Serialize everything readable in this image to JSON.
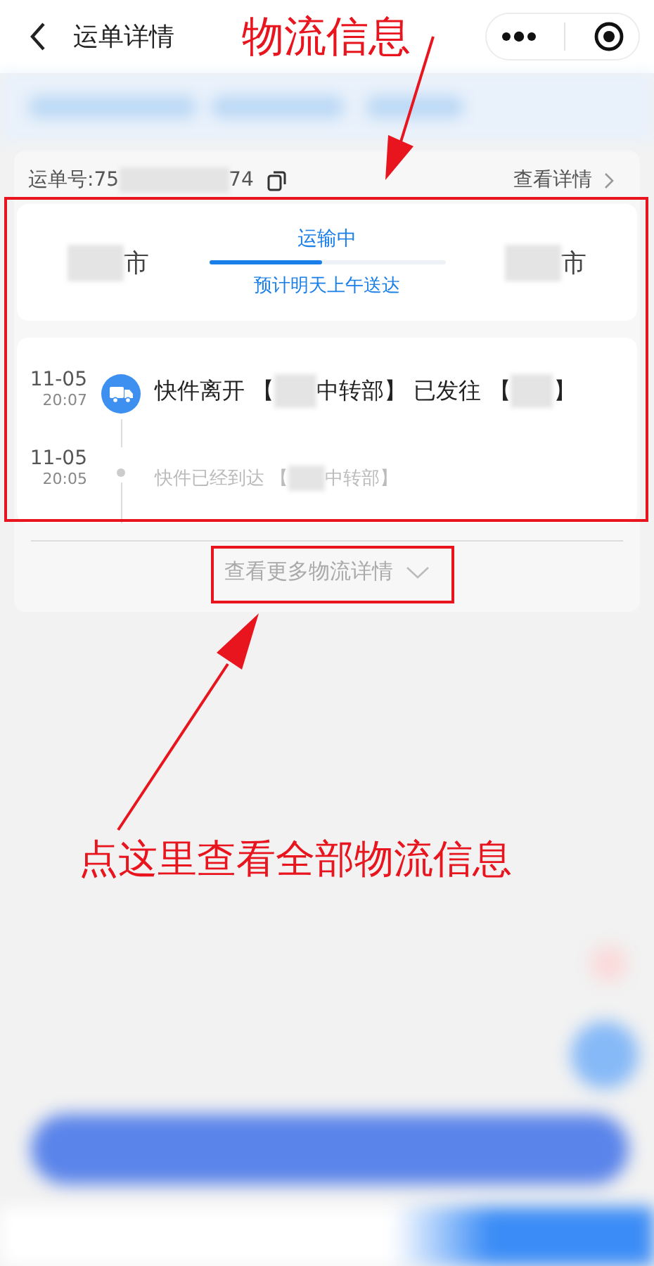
{
  "header": {
    "title": "运单详情"
  },
  "waybill": {
    "number_start": "运单号:75",
    "number_end": "74",
    "details_link": "查看详情"
  },
  "route": {
    "origin_suffix": "市",
    "destination_suffix": "市",
    "status": "运输中",
    "level": 0.48,
    "eta": "预计明天上午送达"
  },
  "events": [
    {
      "date": "11-05",
      "time": "20:07",
      "kind": "current",
      "parts": [
        "快件离开 【",
        "中转部】 已发往 【",
        "】"
      ]
    },
    {
      "date": "11-05",
      "time": "20:05",
      "kind": "past",
      "parts": [
        "快件已经到达 【",
        "中转部】"
      ]
    }
  ],
  "more_link": "查看更多物流详情",
  "annotations": [
    {
      "kind": "top",
      "text": "物流信息"
    },
    {
      "kind": "bottom",
      "text": "点这里查看全部物流信息"
    }
  ]
}
